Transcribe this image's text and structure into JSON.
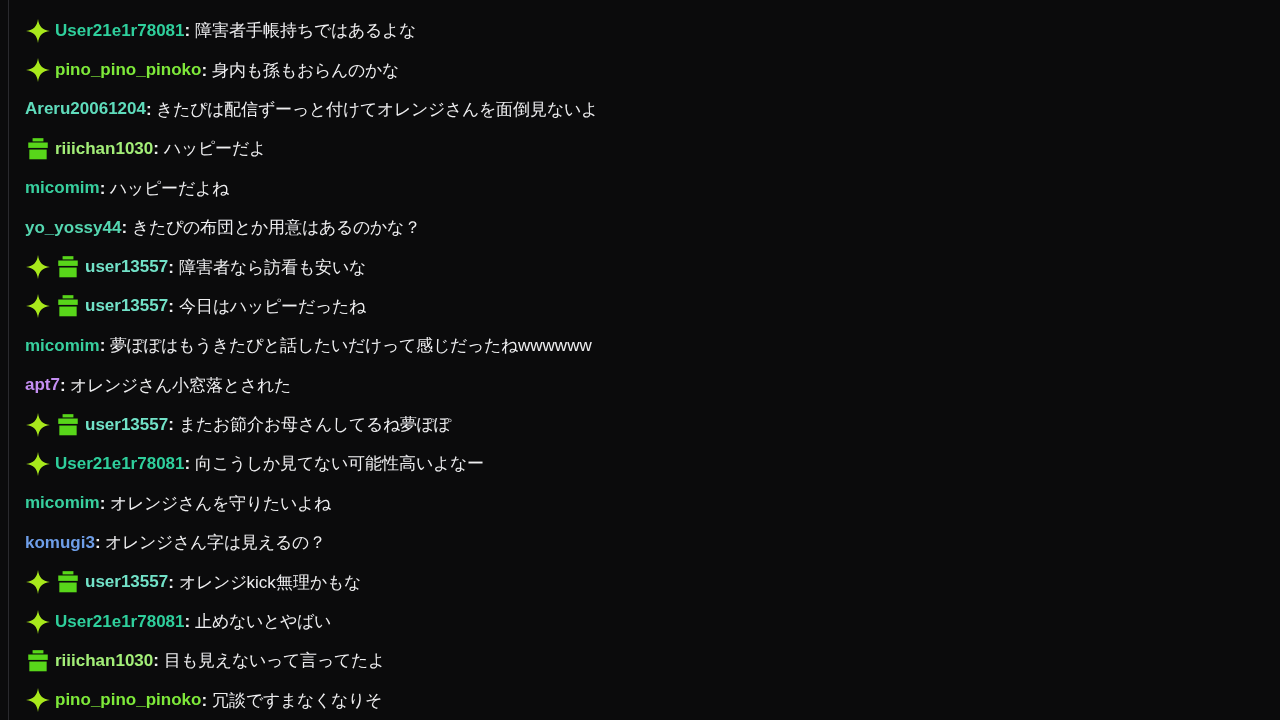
{
  "messages": [
    {
      "sparkle": true,
      "gift": false,
      "name": "User21e1r78081",
      "color": "#2fcf9c",
      "text": "**:** 障害者手帳持ちではあるよな"
    },
    {
      "sparkle": true,
      "gift": false,
      "name": "pino_pino_pinoko",
      "color": "#7ee83a",
      "text": "**:** 身内も孫もおらんのかな"
    },
    {
      "sparkle": false,
      "gift": false,
      "name": "Areru20061204",
      "color": "#5fdcbc",
      "text": "**:** きたぴは配信ずーっと付けてオレンジさんを面倒見ないよ"
    },
    {
      "sparkle": false,
      "gift": true,
      "name": "riiichan1030",
      "color": "#a3ee78",
      "text": "**:** ハッピーだよ"
    },
    {
      "sparkle": false,
      "gift": false,
      "name": "micomim",
      "color": "#38cf9e",
      "text": "**:** ハッピーだよね"
    },
    {
      "sparkle": false,
      "gift": false,
      "name": "yo_yossy44",
      "color": "#55d6b0",
      "text": "**:** きたぴの布団とか用意はあるのかな？"
    },
    {
      "sparkle": true,
      "gift": true,
      "name": "user13557",
      "color": "#72e2c8",
      "text": "**:** 障害者なら訪看も安いな"
    },
    {
      "sparkle": true,
      "gift": true,
      "name": "user13557",
      "color": "#72e2c8",
      "text": "**:** 今日はハッピーだったね"
    },
    {
      "sparkle": false,
      "gift": false,
      "name": "micomim",
      "color": "#38cf9e",
      "text": "**:** 夢ぽぽはもうきたぴと話したいだけって感じだったねwwwwww"
    },
    {
      "sparkle": false,
      "gift": false,
      "name": "apt7",
      "color": "#c48ef2",
      "text": "**:** オレンジさん小窓落とされた"
    },
    {
      "sparkle": true,
      "gift": true,
      "name": "user13557",
      "color": "#72e2c8",
      "text": "**:** またお節介お母さんしてるね夢ぽぽ"
    },
    {
      "sparkle": true,
      "gift": false,
      "name": "User21e1r78081",
      "color": "#2fcf9c",
      "text": "**:** 向こうしか見てない可能性高いよなー"
    },
    {
      "sparkle": false,
      "gift": false,
      "name": "micomim",
      "color": "#38cf9e",
      "text": "**:** オレンジさんを守りたいよね"
    },
    {
      "sparkle": false,
      "gift": false,
      "name": "komugi3",
      "color": "#6e9ee8",
      "text": "**:** オレンジさん字は見えるの？"
    },
    {
      "sparkle": true,
      "gift": true,
      "name": "user13557",
      "color": "#72e2c8",
      "text": "**:** オレンジkick無理かもな"
    },
    {
      "sparkle": true,
      "gift": false,
      "name": "User21e1r78081",
      "color": "#2fcf9c",
      "text": "**:** 止めないとやばい"
    },
    {
      "sparkle": false,
      "gift": true,
      "name": "riiichan1030",
      "color": "#a3ee78",
      "text": "**:** 目も見えないって言ってたよ"
    },
    {
      "sparkle": true,
      "gift": false,
      "name": "pino_pino_pinoko",
      "color": "#7ee83a",
      "text": "**:** 冗談ですまなくなりそ"
    }
  ]
}
